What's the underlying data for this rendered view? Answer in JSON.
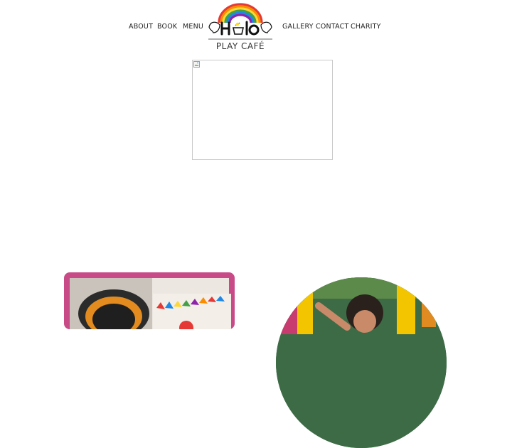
{
  "nav": {
    "left_items": [
      "ABOUT",
      "BOOK",
      "MENU"
    ],
    "right_items": [
      "GALLERY",
      "CONTACT",
      "CHARITY"
    ]
  },
  "logo": {
    "name": "Halo",
    "subtitle": "PLAY CAFÉ"
  },
  "colors": {
    "accent_pink": "#c84a87",
    "text": "#222222",
    "rainbow": [
      "#e53935",
      "#fb8c00",
      "#fdd835",
      "#43a047",
      "#1e88e5",
      "#8e24aa"
    ]
  },
  "icons": [
    "broken-image-icon",
    "rainbow-logo-icon",
    "wing-icon",
    "cup-icon"
  ]
}
